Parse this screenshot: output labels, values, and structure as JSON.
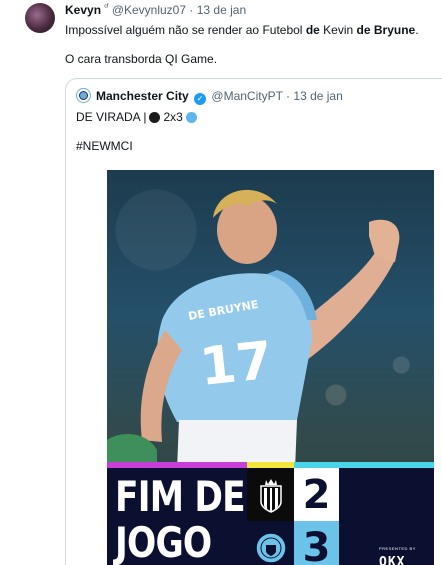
{
  "tweet": {
    "author_name": "Kevyn",
    "author_name_suffix": "ᶜᶠ",
    "handle": "@Kevynluz07",
    "separator": "·",
    "date": "13 de jan",
    "text_line1_a": "Impossível alguém não se render ao Futebol ",
    "text_line1_b": "de",
    "text_line1_c": " Kevin ",
    "text_line1_d": "de Bryune",
    "text_line1_e": ".",
    "text_line2": "O cara transborda QI Game."
  },
  "quoted_tweet": {
    "author_name": "Manchester City",
    "verified_icon": "verified-check-icon",
    "handle": "@ManCityPT",
    "separator": "·",
    "date": "13 de jan",
    "line1_prefix": "DE VIRADA | ",
    "line1_score": "2x3",
    "hashtag": "#NEWMCI",
    "media": {
      "scoreboard": {
        "title_line1": "FIM DE",
        "title_line2": "JOGO",
        "home_score": "2",
        "away_score": "3",
        "presented_by": "PRESENTED BY",
        "sponsor": "OKX",
        "colors": {
          "magenta": "#c63fd9",
          "yellow": "#f2e63b",
          "cyan": "#49d5e7",
          "navy": "#0b1030",
          "city_blue": "#6cc3ea"
        }
      },
      "jersey_number": "17",
      "jersey_name": "DE BRUYNE"
    }
  }
}
